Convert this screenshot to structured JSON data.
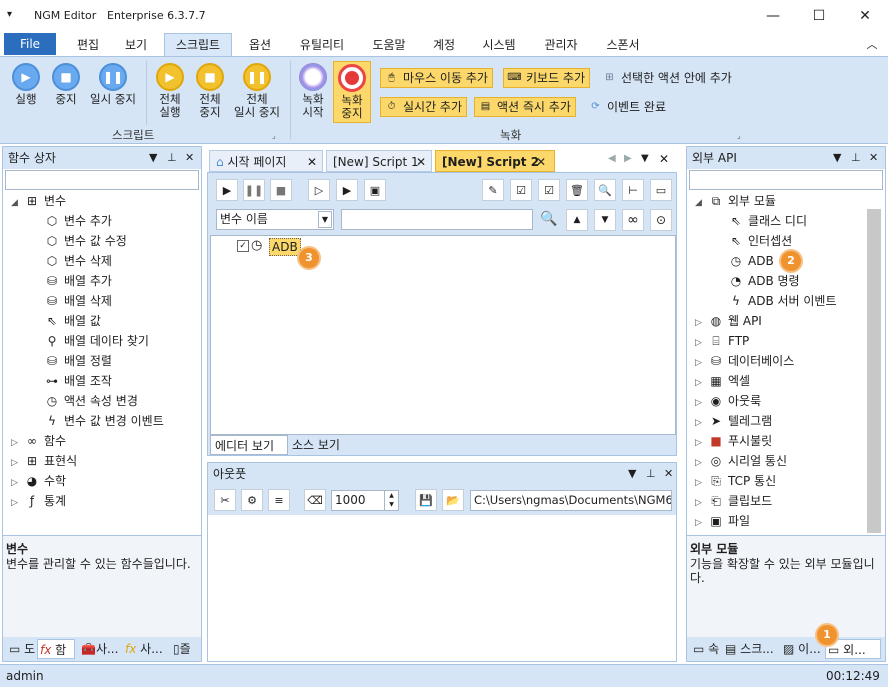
{
  "window": {
    "title": "NGM Editor",
    "edition": "Enterprise 6.3.7.7",
    "minimize": "—",
    "maximize": "☐",
    "close": "✕"
  },
  "menu": {
    "items": [
      "File",
      "편집",
      "보기",
      "스크립트",
      "옵션",
      "유틸리티",
      "도움말",
      "계정",
      "시스템",
      "관리자",
      "스폰서"
    ],
    "collapse": "︿"
  },
  "ribbon": {
    "script_group": {
      "label": "스크립트",
      "run": "실행",
      "stop": "중지",
      "pause": "일시 중지",
      "run_all_1": "전체",
      "run_all_2": "실행",
      "stop_all_1": "전체",
      "stop_all_2": "중지",
      "pause_all_1": "전체",
      "pause_all_2": "일시 중지"
    },
    "record_group": {
      "label": "녹화",
      "start_1": "녹화",
      "start_2": "시작",
      "stop_1": "녹화",
      "stop_2": "중지",
      "add_mouse": "마우스 이동 추가",
      "add_keyboard": "키보드 추가",
      "add_in_selected": "선택한 액션 안에 추가",
      "add_realtime": "실시간 추가",
      "add_action_now": "액션 즉시 추가",
      "event_done": "이벤트 완료"
    }
  },
  "left_panel": {
    "title": "함수 상자",
    "tree": [
      {
        "label": "변수",
        "icon": "group-icon",
        "level": 0,
        "expanded": true
      },
      {
        "label": "변수 추가",
        "icon": "cube-add-icon",
        "level": 1
      },
      {
        "label": "변수 값 수정",
        "icon": "cube-edit-icon",
        "level": 1
      },
      {
        "label": "변수 삭제",
        "icon": "cube-delete-icon",
        "level": 1
      },
      {
        "label": "배열 추가",
        "icon": "database-add-icon",
        "level": 1
      },
      {
        "label": "배열 삭제",
        "icon": "database-delete-icon",
        "level": 1
      },
      {
        "label": "배열 값",
        "icon": "pointer-icon",
        "level": 1
      },
      {
        "label": "배열 데이타 찾기",
        "icon": "search-icon",
        "level": 1
      },
      {
        "label": "배열 정렬",
        "icon": "database-sort-icon",
        "level": 1
      },
      {
        "label": "배열 조작",
        "icon": "toggle-icon",
        "level": 1
      },
      {
        "label": "액션 속성 변경",
        "icon": "clock-icon",
        "level": 1
      },
      {
        "label": "변수 값 변경 이벤트",
        "icon": "bolt-icon",
        "level": 1
      },
      {
        "label": "함수",
        "icon": "infinity-icon",
        "level": 0,
        "expanded": false
      },
      {
        "label": "표현식",
        "icon": "grid-icon",
        "level": 0,
        "expanded": false
      },
      {
        "label": "수학",
        "icon": "pie-icon",
        "level": 0,
        "expanded": false
      },
      {
        "label": "통계",
        "icon": "fx-icon",
        "level": 0,
        "expanded": false
      }
    ],
    "desc_title": "변수",
    "desc_text": "변수를 관리할 수 있는 함수들입니다.",
    "tabs": [
      "도",
      "함",
      "사...",
      "사...",
      "즐"
    ]
  },
  "doc_tabs": [
    "시작 페이지",
    "[New] Script 1",
    "[New] Script 2"
  ],
  "editor": {
    "search_combo": "변수 이름",
    "node_label": "ADB",
    "view_tabs": [
      "에디터 보기",
      "소스 보기"
    ]
  },
  "output": {
    "title": "아웃풋",
    "count": "1000",
    "path": "C:\\Users\\ngmas\\Documents\\NGM6\\"
  },
  "right_panel": {
    "title": "외부 API",
    "tree": [
      {
        "label": "외부 모듈",
        "icon": "external-icon",
        "level": 0,
        "expanded": true
      },
      {
        "label": "클래스 디디",
        "icon": "pointer-icon",
        "level": 1
      },
      {
        "label": "인터셉션",
        "icon": "pointer-icon",
        "level": 1
      },
      {
        "label": "ADB",
        "icon": "adb-icon",
        "level": 1
      },
      {
        "label": "ADB 명령",
        "icon": "adb-command-icon",
        "level": 1
      },
      {
        "label": "ADB 서버 이벤트",
        "icon": "bolt-icon",
        "level": 1
      },
      {
        "label": "웹 API",
        "icon": "globe-icon",
        "level": 0
      },
      {
        "label": "FTP",
        "icon": "ftp-icon",
        "level": 0
      },
      {
        "label": "데이터베이스",
        "icon": "database-icon",
        "level": 0
      },
      {
        "label": "엑셀",
        "icon": "excel-icon",
        "level": 0
      },
      {
        "label": "아웃룩",
        "icon": "outlook-icon",
        "level": 0
      },
      {
        "label": "텔레그램",
        "icon": "telegram-icon",
        "level": 0
      },
      {
        "label": "푸시불릿",
        "icon": "pushbullet-icon",
        "level": 0
      },
      {
        "label": "시리얼 통신",
        "icon": "serial-icon",
        "level": 0
      },
      {
        "label": "TCP 통신",
        "icon": "tcp-icon",
        "level": 0
      },
      {
        "label": "클립보드",
        "icon": "clipboard-icon",
        "level": 0
      },
      {
        "label": "파일",
        "icon": "file-icon",
        "level": 0
      }
    ],
    "desc_title": "외부 모듈",
    "desc_text": "기능을 확장할 수 있는 외부 모듈입니다.",
    "tabs": [
      "속",
      "스크...",
      "이...",
      "외..."
    ]
  },
  "badges": [
    "1",
    "2",
    "3"
  ],
  "status": {
    "user": "admin",
    "time": "00:12:49"
  },
  "colors": {
    "accent": "#2a6ebd",
    "ribbon": "#d6e5f6",
    "highlight": "#fcd86b",
    "badge": "#f0922e"
  }
}
